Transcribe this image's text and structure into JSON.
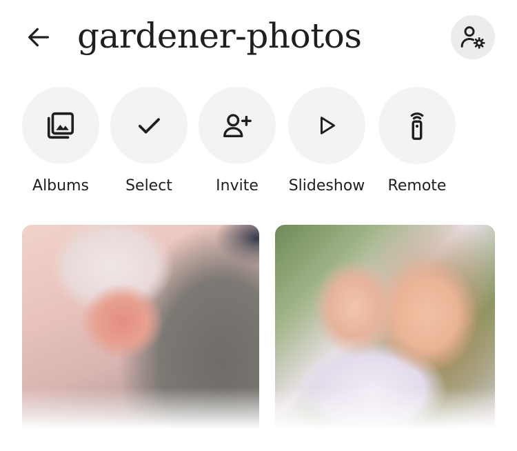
{
  "header": {
    "title": "gardener-photos",
    "back_icon": "arrow-left-icon",
    "settings_icon": "person-gear-icon"
  },
  "actions": [
    {
      "label": "Albums",
      "icon": "albums-icon"
    },
    {
      "label": "Select",
      "icon": "check-icon"
    },
    {
      "label": "Invite",
      "icon": "person-add-icon"
    },
    {
      "label": "Slideshow",
      "icon": "play-icon"
    },
    {
      "label": "Remote",
      "icon": "remote-icon"
    }
  ],
  "photos": [
    {
      "name": "photo-baby-in-winter-hat"
    },
    {
      "name": "photo-mother-and-daughter-flowers"
    }
  ],
  "colors": {
    "background": "#ffffff",
    "button_background": "#f3f3f3",
    "settings_background": "#ececec",
    "text": "#1f1f1f"
  }
}
